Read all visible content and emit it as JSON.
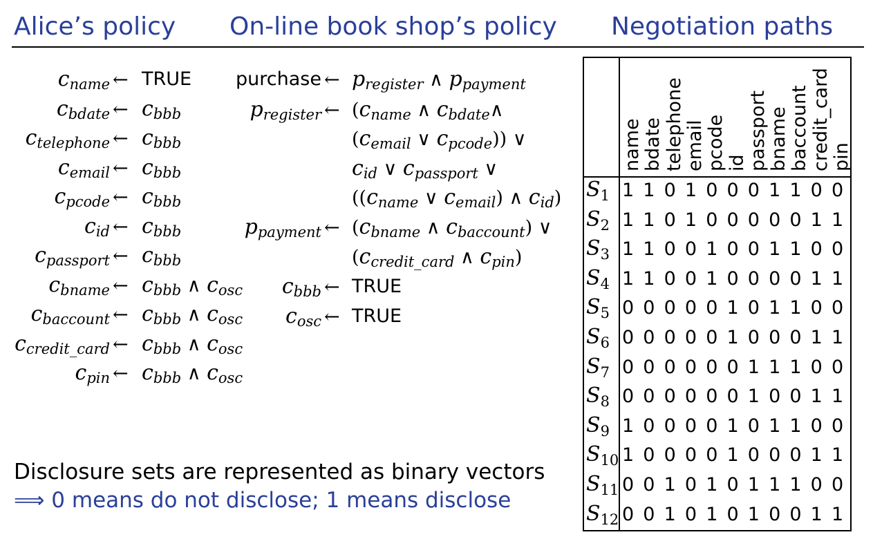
{
  "headings": {
    "alice": "Alice’s policy",
    "shop": "On-line book shop’s policy",
    "paths": "Negotiation paths"
  },
  "alice_rules": [
    {
      "lhs_v": "c",
      "lhs_s": "name",
      "rhs": [
        [
          "kw",
          "TRUE"
        ]
      ]
    },
    {
      "lhs_v": "c",
      "lhs_s": "bdate",
      "rhs": [
        [
          "v",
          "c",
          "bbb"
        ]
      ]
    },
    {
      "lhs_v": "c",
      "lhs_s": "telephone",
      "rhs": [
        [
          "v",
          "c",
          "bbb"
        ]
      ]
    },
    {
      "lhs_v": "c",
      "lhs_s": "email",
      "rhs": [
        [
          "v",
          "c",
          "bbb"
        ]
      ]
    },
    {
      "lhs_v": "c",
      "lhs_s": "pcode",
      "rhs": [
        [
          "v",
          "c",
          "bbb"
        ]
      ]
    },
    {
      "lhs_v": "c",
      "lhs_s": "id",
      "rhs": [
        [
          "v",
          "c",
          "bbb"
        ]
      ]
    },
    {
      "lhs_v": "c",
      "lhs_s": "passport",
      "rhs": [
        [
          "v",
          "c",
          "bbb"
        ]
      ]
    },
    {
      "lhs_v": "c",
      "lhs_s": "bname",
      "rhs": [
        [
          "v",
          "c",
          "bbb"
        ],
        [
          "op",
          " ∧ "
        ],
        [
          "v",
          "c",
          "osc"
        ]
      ]
    },
    {
      "lhs_v": "c",
      "lhs_s": "baccount",
      "rhs": [
        [
          "v",
          "c",
          "bbb"
        ],
        [
          "op",
          " ∧ "
        ],
        [
          "v",
          "c",
          "osc"
        ]
      ]
    },
    {
      "lhs_v": "c",
      "lhs_s": "credit_card",
      "rhs": [
        [
          "v",
          "c",
          "bbb"
        ],
        [
          "op",
          " ∧ "
        ],
        [
          "v",
          "c",
          "osc"
        ]
      ]
    },
    {
      "lhs_v": "c",
      "lhs_s": "pin",
      "rhs": [
        [
          "v",
          "c",
          "bbb"
        ],
        [
          "op",
          " ∧ "
        ],
        [
          "v",
          "c",
          "osc"
        ]
      ]
    }
  ],
  "shop_rules": [
    {
      "lhs": [
        [
          "kw",
          "purchase"
        ]
      ],
      "rhs": [
        [
          "v",
          "p",
          "register"
        ],
        [
          "op",
          " ∧ "
        ],
        [
          "v",
          "p",
          "payment"
        ]
      ]
    },
    {
      "lhs": [
        [
          "v",
          "p",
          "register"
        ]
      ],
      "rhs": [
        [
          "op",
          "("
        ],
        [
          "v",
          "c",
          "name"
        ],
        [
          "op",
          " ∧ "
        ],
        [
          "v",
          "c",
          "bdate"
        ],
        [
          "op",
          "∧"
        ]
      ]
    },
    {
      "lhs": null,
      "rhs": [
        [
          "op",
          "("
        ],
        [
          "v",
          "c",
          "email"
        ],
        [
          "op",
          " ∨ "
        ],
        [
          "v",
          "c",
          "pcode"
        ],
        [
          "op",
          ")) ∨"
        ]
      ]
    },
    {
      "lhs": null,
      "rhs": [
        [
          "v",
          "c",
          "id"
        ],
        [
          "op",
          " ∨ "
        ],
        [
          "v",
          "c",
          "passport"
        ],
        [
          "op",
          " ∨"
        ]
      ]
    },
    {
      "lhs": null,
      "rhs": [
        [
          "op",
          "(("
        ],
        [
          "v",
          "c",
          "name"
        ],
        [
          "op",
          " ∨ "
        ],
        [
          "v",
          "c",
          "email"
        ],
        [
          "op",
          ") ∧ "
        ],
        [
          "v",
          "c",
          "id"
        ],
        [
          "op",
          ")"
        ]
      ]
    },
    {
      "lhs": [
        [
          "v",
          "p",
          "payment"
        ]
      ],
      "rhs": [
        [
          "op",
          "("
        ],
        [
          "v",
          "c",
          "bname"
        ],
        [
          "op",
          " ∧ "
        ],
        [
          "v",
          "c",
          "baccount"
        ],
        [
          "op",
          ") ∨"
        ]
      ]
    },
    {
      "lhs": null,
      "rhs": [
        [
          "op",
          "("
        ],
        [
          "v",
          "c",
          "credit_card"
        ],
        [
          "op",
          " ∧ "
        ],
        [
          "v",
          "c",
          "pin"
        ],
        [
          "op",
          ")"
        ]
      ]
    },
    {
      "lhs": [
        [
          "v",
          "c",
          "bbb"
        ]
      ],
      "rhs": [
        [
          "kw",
          "TRUE"
        ]
      ]
    },
    {
      "lhs": [
        [
          "v",
          "c",
          "osc"
        ]
      ],
      "rhs": [
        [
          "kw",
          "TRUE"
        ]
      ]
    }
  ],
  "arrow": "←",
  "footer": {
    "line1": "Disclosure sets are represented as binary vectors",
    "line2": "⟹ 0 means do not disclose; 1 means disclose"
  },
  "columns": [
    "name",
    "bdate",
    "telephone",
    "email",
    "pcode",
    "id",
    "passport",
    "bname",
    "baccount",
    "credit_card",
    "pin"
  ],
  "rows": [
    {
      "label": "S",
      "sub": "1",
      "bits": "11010001100"
    },
    {
      "label": "S",
      "sub": "2",
      "bits": "11010000011"
    },
    {
      "label": "S",
      "sub": "3",
      "bits": "11001001100"
    },
    {
      "label": "S",
      "sub": "4",
      "bits": "11001000011"
    },
    {
      "label": "S",
      "sub": "5",
      "bits": "00000101100"
    },
    {
      "label": "S",
      "sub": "6",
      "bits": "00000100011"
    },
    {
      "label": "S",
      "sub": "7",
      "bits": "00000011100"
    },
    {
      "label": "S",
      "sub": "8",
      "bits": "00000010011"
    },
    {
      "label": "S",
      "sub": "9",
      "bits": "10000101100"
    },
    {
      "label": "S",
      "sub": "10",
      "bits": "10000100011"
    },
    {
      "label": "S",
      "sub": "11",
      "bits": "00101011100"
    },
    {
      "label": "S",
      "sub": "12",
      "bits": "00101010011"
    }
  ]
}
